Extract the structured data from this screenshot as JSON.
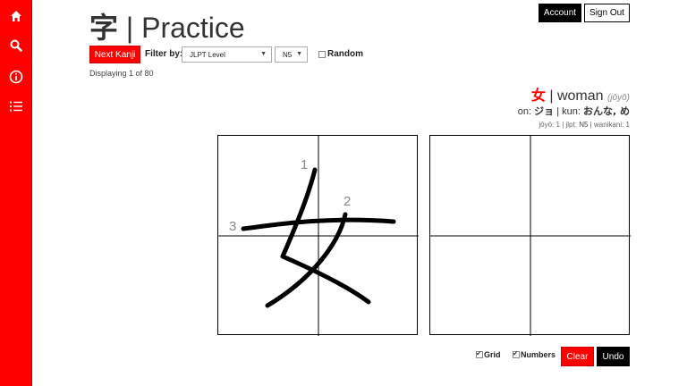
{
  "sidebar": {
    "icons": [
      "home-icon",
      "search-icon",
      "info-icon",
      "list-icon"
    ]
  },
  "header": {
    "kanji": "字",
    "separator": " | ",
    "title": "Practice"
  },
  "account": {
    "account_label": "Account",
    "signout_label": "Sign Out"
  },
  "controls": {
    "next_label": "Next Kanji",
    "filter_label": "Filter by:",
    "filter_select_value": "JLPT Level",
    "level_select_value": "N5",
    "random_label": "Random",
    "random_checked": false
  },
  "status": {
    "displaying": "Displaying 1 of 80"
  },
  "kanji_info": {
    "character": "女",
    "meaning": "woman",
    "note": "(jōyō)",
    "on_label": "on:",
    "on_reading": "ジョ",
    "kun_label": "kun:",
    "kun_reading": "おんな, め",
    "stats_jouyou": "jōyō: 1",
    "stats_jlpt_label": "jlpt:",
    "stats_jlpt_value": "N5",
    "stats_wanikani": "wanikani: 1"
  },
  "stroke_numbers": [
    "1",
    "2",
    "3"
  ],
  "bottom_controls": {
    "grid_label": "Grid",
    "grid_checked": true,
    "numbers_label": "Numbers",
    "numbers_checked": true,
    "clear_label": "Clear",
    "undo_label": "Undo"
  },
  "colors": {
    "accent": "#ff0000",
    "dark": "#000000"
  }
}
